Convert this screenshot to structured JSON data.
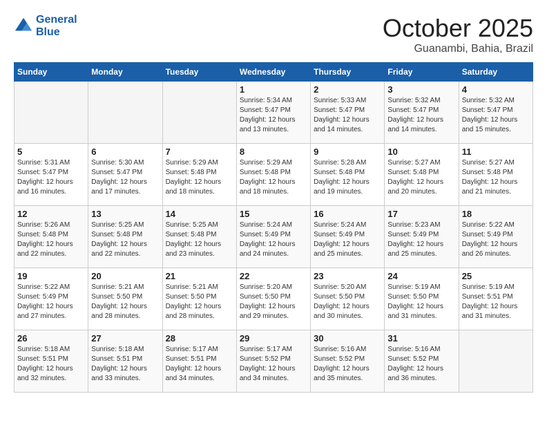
{
  "header": {
    "logo_line1": "General",
    "logo_line2": "Blue",
    "month": "October 2025",
    "location": "Guanambi, Bahia, Brazil"
  },
  "days_of_week": [
    "Sunday",
    "Monday",
    "Tuesday",
    "Wednesday",
    "Thursday",
    "Friday",
    "Saturday"
  ],
  "weeks": [
    [
      {
        "num": "",
        "info": ""
      },
      {
        "num": "",
        "info": ""
      },
      {
        "num": "",
        "info": ""
      },
      {
        "num": "1",
        "info": "Sunrise: 5:34 AM\nSunset: 5:47 PM\nDaylight: 12 hours\nand 13 minutes."
      },
      {
        "num": "2",
        "info": "Sunrise: 5:33 AM\nSunset: 5:47 PM\nDaylight: 12 hours\nand 14 minutes."
      },
      {
        "num": "3",
        "info": "Sunrise: 5:32 AM\nSunset: 5:47 PM\nDaylight: 12 hours\nand 14 minutes."
      },
      {
        "num": "4",
        "info": "Sunrise: 5:32 AM\nSunset: 5:47 PM\nDaylight: 12 hours\nand 15 minutes."
      }
    ],
    [
      {
        "num": "5",
        "info": "Sunrise: 5:31 AM\nSunset: 5:47 PM\nDaylight: 12 hours\nand 16 minutes."
      },
      {
        "num": "6",
        "info": "Sunrise: 5:30 AM\nSunset: 5:47 PM\nDaylight: 12 hours\nand 17 minutes."
      },
      {
        "num": "7",
        "info": "Sunrise: 5:29 AM\nSunset: 5:48 PM\nDaylight: 12 hours\nand 18 minutes."
      },
      {
        "num": "8",
        "info": "Sunrise: 5:29 AM\nSunset: 5:48 PM\nDaylight: 12 hours\nand 18 minutes."
      },
      {
        "num": "9",
        "info": "Sunrise: 5:28 AM\nSunset: 5:48 PM\nDaylight: 12 hours\nand 19 minutes."
      },
      {
        "num": "10",
        "info": "Sunrise: 5:27 AM\nSunset: 5:48 PM\nDaylight: 12 hours\nand 20 minutes."
      },
      {
        "num": "11",
        "info": "Sunrise: 5:27 AM\nSunset: 5:48 PM\nDaylight: 12 hours\nand 21 minutes."
      }
    ],
    [
      {
        "num": "12",
        "info": "Sunrise: 5:26 AM\nSunset: 5:48 PM\nDaylight: 12 hours\nand 22 minutes."
      },
      {
        "num": "13",
        "info": "Sunrise: 5:25 AM\nSunset: 5:48 PM\nDaylight: 12 hours\nand 22 minutes."
      },
      {
        "num": "14",
        "info": "Sunrise: 5:25 AM\nSunset: 5:48 PM\nDaylight: 12 hours\nand 23 minutes."
      },
      {
        "num": "15",
        "info": "Sunrise: 5:24 AM\nSunset: 5:49 PM\nDaylight: 12 hours\nand 24 minutes."
      },
      {
        "num": "16",
        "info": "Sunrise: 5:24 AM\nSunset: 5:49 PM\nDaylight: 12 hours\nand 25 minutes."
      },
      {
        "num": "17",
        "info": "Sunrise: 5:23 AM\nSunset: 5:49 PM\nDaylight: 12 hours\nand 25 minutes."
      },
      {
        "num": "18",
        "info": "Sunrise: 5:22 AM\nSunset: 5:49 PM\nDaylight: 12 hours\nand 26 minutes."
      }
    ],
    [
      {
        "num": "19",
        "info": "Sunrise: 5:22 AM\nSunset: 5:49 PM\nDaylight: 12 hours\nand 27 minutes."
      },
      {
        "num": "20",
        "info": "Sunrise: 5:21 AM\nSunset: 5:50 PM\nDaylight: 12 hours\nand 28 minutes."
      },
      {
        "num": "21",
        "info": "Sunrise: 5:21 AM\nSunset: 5:50 PM\nDaylight: 12 hours\nand 28 minutes."
      },
      {
        "num": "22",
        "info": "Sunrise: 5:20 AM\nSunset: 5:50 PM\nDaylight: 12 hours\nand 29 minutes."
      },
      {
        "num": "23",
        "info": "Sunrise: 5:20 AM\nSunset: 5:50 PM\nDaylight: 12 hours\nand 30 minutes."
      },
      {
        "num": "24",
        "info": "Sunrise: 5:19 AM\nSunset: 5:50 PM\nDaylight: 12 hours\nand 31 minutes."
      },
      {
        "num": "25",
        "info": "Sunrise: 5:19 AM\nSunset: 5:51 PM\nDaylight: 12 hours\nand 31 minutes."
      }
    ],
    [
      {
        "num": "26",
        "info": "Sunrise: 5:18 AM\nSunset: 5:51 PM\nDaylight: 12 hours\nand 32 minutes."
      },
      {
        "num": "27",
        "info": "Sunrise: 5:18 AM\nSunset: 5:51 PM\nDaylight: 12 hours\nand 33 minutes."
      },
      {
        "num": "28",
        "info": "Sunrise: 5:17 AM\nSunset: 5:51 PM\nDaylight: 12 hours\nand 34 minutes."
      },
      {
        "num": "29",
        "info": "Sunrise: 5:17 AM\nSunset: 5:52 PM\nDaylight: 12 hours\nand 34 minutes."
      },
      {
        "num": "30",
        "info": "Sunrise: 5:16 AM\nSunset: 5:52 PM\nDaylight: 12 hours\nand 35 minutes."
      },
      {
        "num": "31",
        "info": "Sunrise: 5:16 AM\nSunset: 5:52 PM\nDaylight: 12 hours\nand 36 minutes."
      },
      {
        "num": "",
        "info": ""
      }
    ]
  ]
}
